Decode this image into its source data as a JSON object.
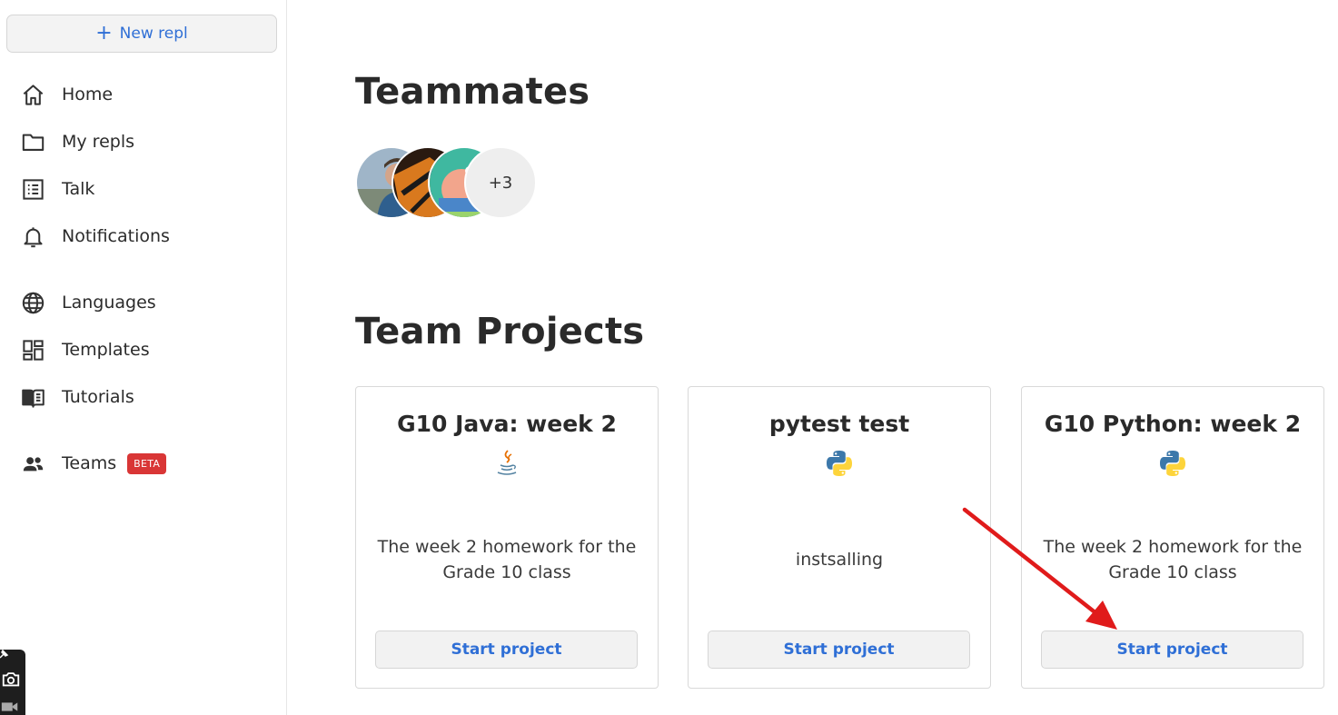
{
  "sidebar": {
    "new_repl_label": "New repl",
    "items": [
      {
        "label": "Home",
        "icon": "home-icon"
      },
      {
        "label": "My repls",
        "icon": "folder-icon"
      },
      {
        "label": "Talk",
        "icon": "list-icon"
      },
      {
        "label": "Notifications",
        "icon": "bell-icon"
      },
      {
        "label": "Languages",
        "icon": "globe-icon"
      },
      {
        "label": "Templates",
        "icon": "templates-icon"
      },
      {
        "label": "Tutorials",
        "icon": "book-icon"
      },
      {
        "label": "Teams",
        "icon": "people-icon",
        "badge": "BETA"
      }
    ]
  },
  "teammates": {
    "title": "Teammates",
    "more_count": "+3"
  },
  "projects": {
    "title": "Team Projects",
    "items": [
      {
        "title": "G10 Java: week 2",
        "language": "java",
        "description": "The week 2 homework for the Grade 10 class",
        "button": "Start project"
      },
      {
        "title": "pytest test",
        "language": "python",
        "description": "instsalling",
        "button": "Start project"
      },
      {
        "title": "G10 Python: week 2",
        "language": "python",
        "description": "The week 2 homework for the Grade 10 class",
        "button": "Start project"
      }
    ]
  },
  "colors": {
    "accent": "#2f6fd6",
    "beta_badge": "#d93636",
    "annotation_arrow": "#e01b1b"
  }
}
